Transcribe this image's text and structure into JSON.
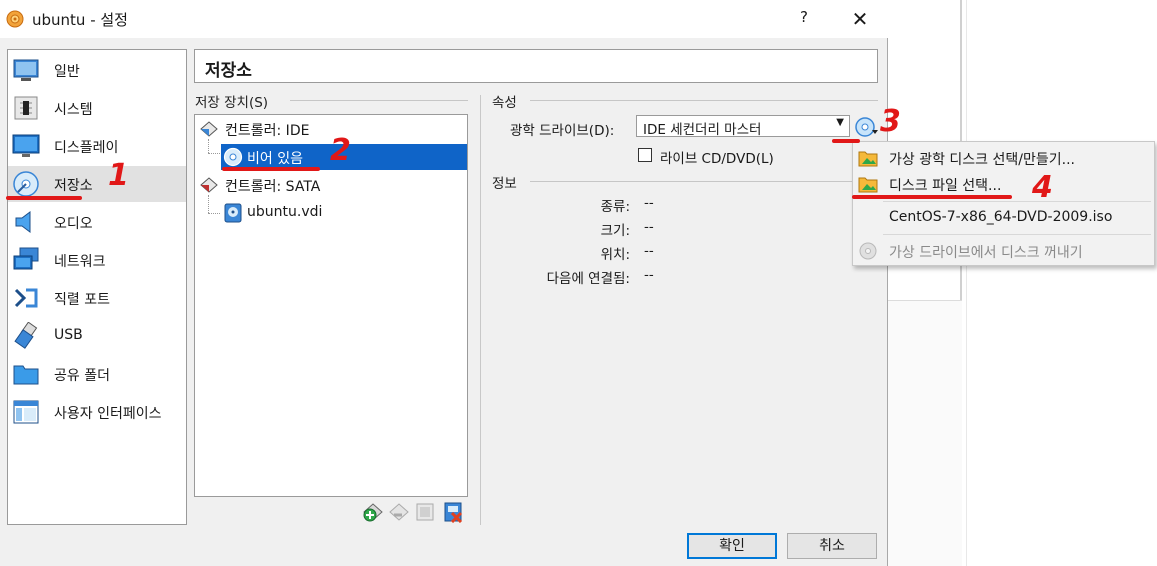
{
  "window": {
    "title": "ubuntu - 설정",
    "help_label": "?",
    "close_label": "✕"
  },
  "sidebar": {
    "items": [
      {
        "label": "일반",
        "icon": "general-icon"
      },
      {
        "label": "시스템",
        "icon": "system-chip-icon"
      },
      {
        "label": "디스플레이",
        "icon": "display-monitor-icon"
      },
      {
        "label": "저장소",
        "icon": "storage-disk-icon",
        "selected": true
      },
      {
        "label": "오디오",
        "icon": "audio-speaker-icon"
      },
      {
        "label": "네트워크",
        "icon": "network-icon"
      },
      {
        "label": "직렬 포트",
        "icon": "serial-port-icon"
      },
      {
        "label": "USB",
        "icon": "usb-icon"
      },
      {
        "label": "공유 폴더",
        "icon": "shared-folder-icon"
      },
      {
        "label": "사용자 인터페이스",
        "icon": "user-interface-icon"
      }
    ]
  },
  "page": {
    "title": "저장소"
  },
  "storage": {
    "section_label": "저장 장치(S)",
    "tree": [
      {
        "label": "컨트롤러: IDE",
        "icon": "ide-controller-icon"
      },
      {
        "label": "비어 있음",
        "icon": "optical-disc-icon",
        "selected": true
      },
      {
        "label": "컨트롤러: SATA",
        "icon": "sata-controller-icon"
      },
      {
        "label": "ubuntu.vdi",
        "icon": "hard-disk-icon"
      }
    ]
  },
  "attributes": {
    "section_label": "속성",
    "drive_label": "광학 드라이브(D):",
    "drive_value": "IDE 세컨더리 마스터",
    "live_cd_label": "라이브 CD/DVD(L)",
    "live_cd_checked": false
  },
  "info": {
    "section_label": "정보",
    "rows": [
      {
        "key": "종류:",
        "value": "--"
      },
      {
        "key": "크기:",
        "value": "--"
      },
      {
        "key": "위치:",
        "value": "--"
      },
      {
        "key": "다음에 연결됨:",
        "value": "--"
      }
    ]
  },
  "menu": {
    "items": [
      {
        "label": "가상 광학 디스크 선택/만들기...",
        "icon": "folder-icon"
      },
      {
        "label": "디스크 파일 선택...",
        "icon": "folder-icon"
      },
      {
        "label": "CentOS-7-x86_64-DVD-2009.iso",
        "icon": ""
      },
      {
        "label": "가상 드라이브에서 디스크 꺼내기",
        "icon": "eject-disc-icon",
        "disabled": true
      }
    ]
  },
  "buttons": {
    "ok": "확인",
    "cancel": "취소"
  },
  "annotations": {
    "n1": "1",
    "n2": "2",
    "n3": "3",
    "n4": "4",
    "color": "#e11818"
  },
  "colors": {
    "selection": "#0f64c8",
    "sidebar_selected": "#e1e1e1",
    "dialog_bg": "#f0f0f0"
  }
}
